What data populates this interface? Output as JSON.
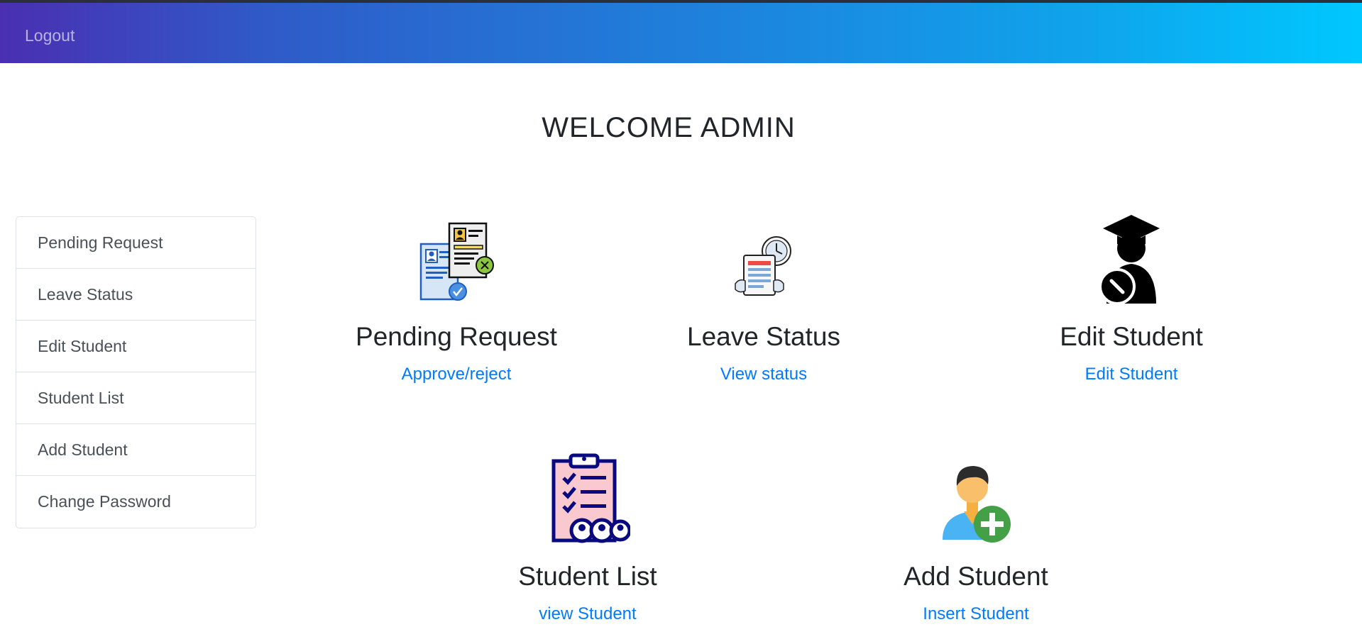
{
  "nav": {
    "logout_label": "Logout"
  },
  "page": {
    "heading": "WELCOME ADMIN"
  },
  "sidebar": {
    "items": [
      {
        "label": "Pending Request"
      },
      {
        "label": "Leave Status"
      },
      {
        "label": "Edit Student"
      },
      {
        "label": "Student List"
      },
      {
        "label": "Add Student"
      },
      {
        "label": "Change Password"
      }
    ]
  },
  "cards": [
    {
      "title": "Pending Request",
      "link": "Approve/reject",
      "icon": "documents-approval-icon"
    },
    {
      "title": "Leave Status",
      "link": "View status",
      "icon": "clipboard-clock-icon"
    },
    {
      "title": "Edit Student",
      "link": "Edit Student",
      "icon": "graduate-edit-icon"
    },
    {
      "title": "Student List",
      "link": "view Student",
      "icon": "checklist-group-icon"
    },
    {
      "title": "Add Student",
      "link": "Insert Student",
      "icon": "user-add-icon"
    }
  ],
  "colors": {
    "link": "#007bff",
    "gradient_start": "#4a2fb2",
    "gradient_end": "#00c8ff"
  }
}
